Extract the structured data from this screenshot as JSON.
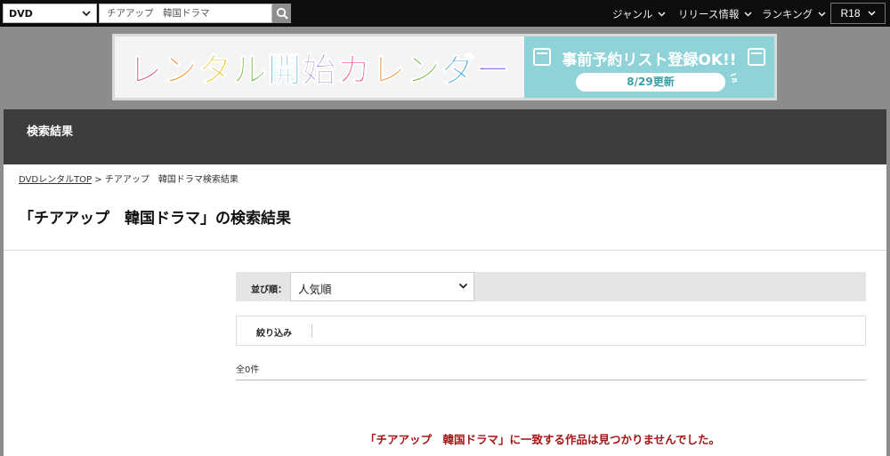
{
  "topbar": {
    "category": "DVD",
    "search_value": "チアアップ　韓国ドラマ",
    "nav": [
      "ジャンル",
      "リリース情報",
      "ランキング"
    ],
    "r18": "R18"
  },
  "banner": {
    "title": "レンタル開始カレンダー",
    "promo": "事前予約リスト登録OK!!",
    "date": "8/29更新"
  },
  "section": {
    "title": "検索結果"
  },
  "breadcrumb": {
    "home": "DVDレンタルTOP",
    "sep": " > ",
    "current": "チアアップ　韓国ドラマ検索結果"
  },
  "result_title": "「チアアップ　韓国ドラマ」の検索結果",
  "sort": {
    "label": "並び順：",
    "selected": "人気順"
  },
  "filter": {
    "label": "絞り込み"
  },
  "count": "全0件",
  "no_result": "「チアアップ　韓国ドラマ」に一致する作品は見つかりませんでした。",
  "colors": {
    "accent_red": "#a31515",
    "teal": "#8fd3d8",
    "topbar": "#0d0d0d"
  }
}
